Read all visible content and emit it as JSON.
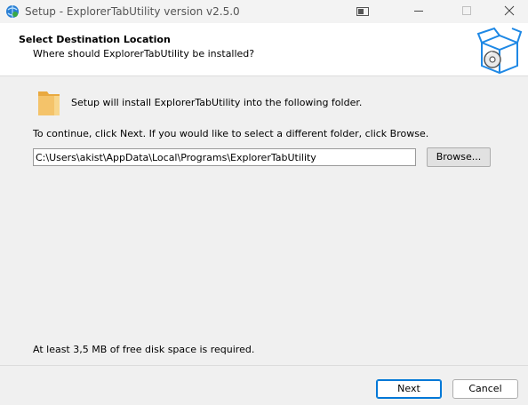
{
  "window": {
    "title": "Setup - ExplorerTabUtility version v2.5.0",
    "icons": {
      "app": "setup-globe-icon",
      "minimize": "minimize-icon",
      "maximize": "maximize-icon",
      "close": "close-icon",
      "gripper": "window-gripper-icon"
    }
  },
  "header": {
    "title": "Select Destination Location",
    "subtitle": "Where should ExplorerTabUtility be installed?",
    "icon": "installer-box-icon"
  },
  "body": {
    "folder_icon": "folder-icon",
    "info": "Setup will install ExplorerTabUtility into the following folder.",
    "instruction": "To continue, click Next. If you would like to select a different folder, click Browse.",
    "path_value": "C:\\Users\\akist\\AppData\\Local\\Programs\\ExplorerTabUtility",
    "browse_label": "Browse...",
    "disk_space": "At least 3,5 MB of free disk space is required."
  },
  "footer": {
    "next_label": "Next",
    "cancel_label": "Cancel"
  },
  "colors": {
    "accent": "#0078d7",
    "folder": "#f4c36a",
    "box": "#1e88e5"
  }
}
